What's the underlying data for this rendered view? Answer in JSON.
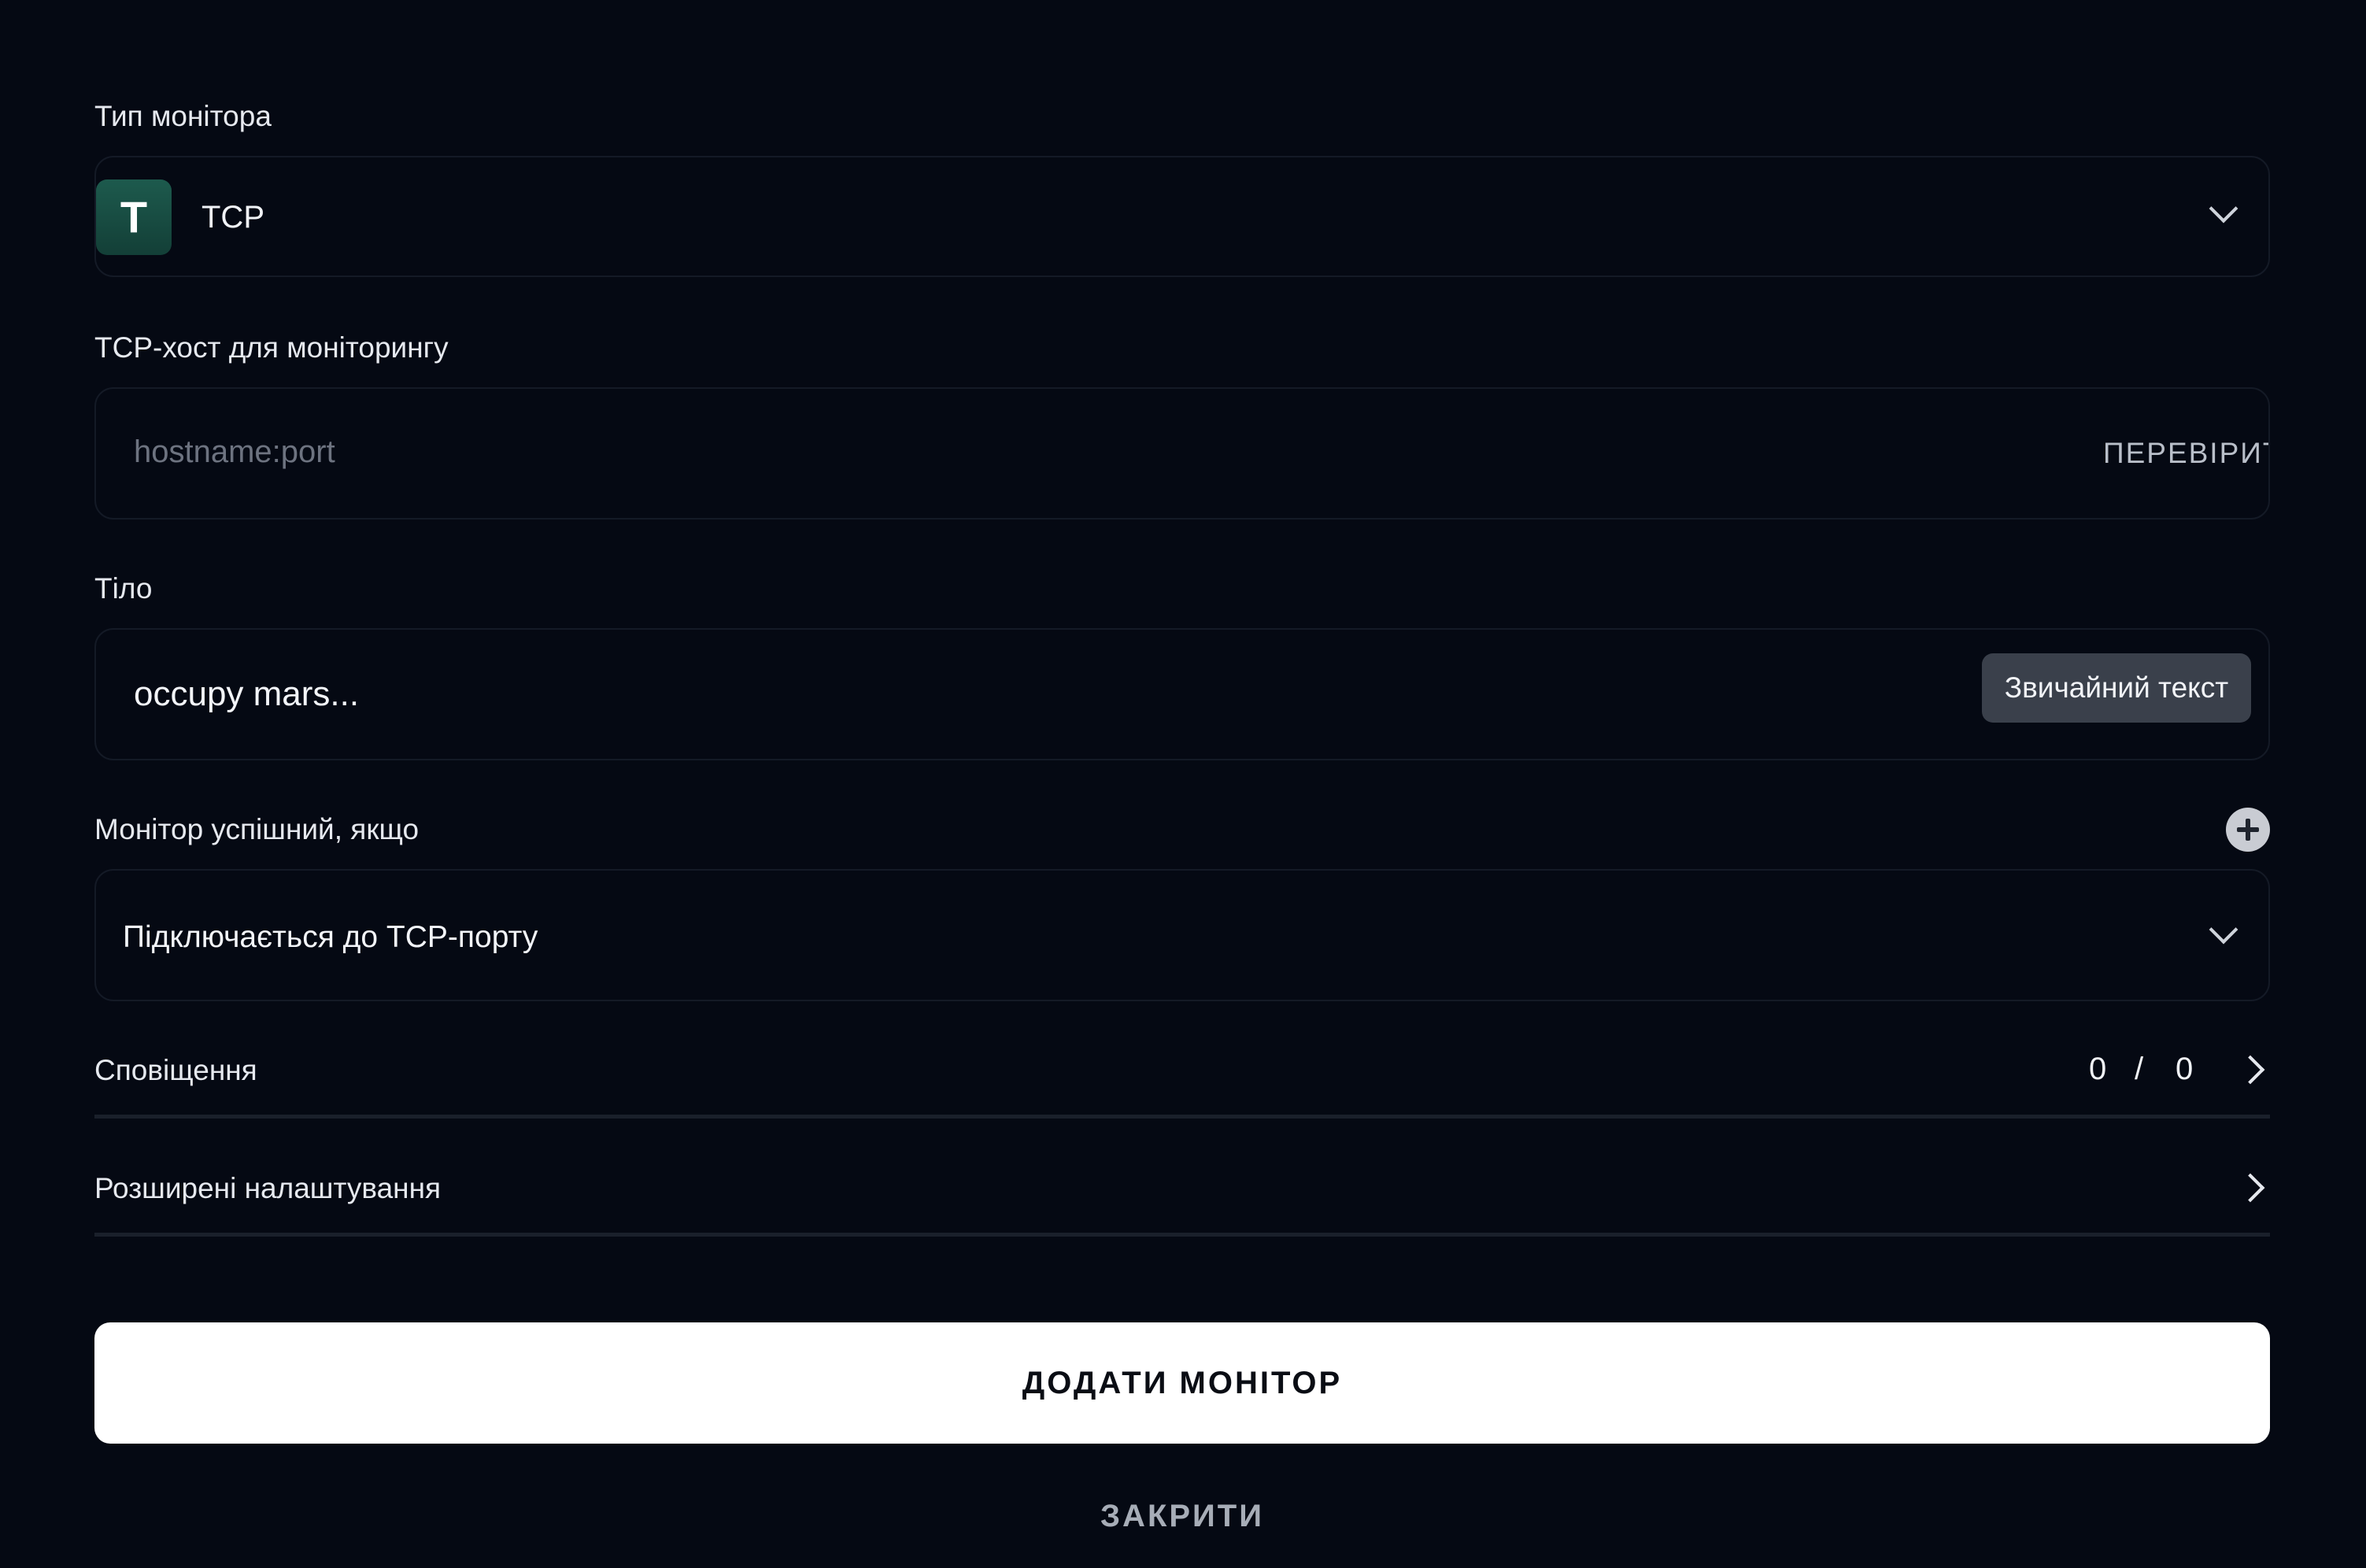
{
  "monitor_type": {
    "label": "Тип монітора",
    "icon_letter": "T",
    "value": "TCP",
    "icon_color": "#1d5a4d"
  },
  "tcp_host": {
    "label": "TCP-хост для моніторингу",
    "placeholder": "hostname:port",
    "value": "",
    "verify_label": "ПЕРЕВІРИТИ"
  },
  "body": {
    "label": "Тіло",
    "value": "occupy mars...",
    "format_label": "Звичайний текст"
  },
  "success_condition": {
    "label": "Монітор успішний, якщо",
    "value": "Підключається до TCP-порту"
  },
  "notifications": {
    "label": "Сповіщення",
    "count_selected": "0",
    "separator": "/",
    "count_total": "0"
  },
  "advanced": {
    "label": "Розширені налаштування"
  },
  "actions": {
    "add_label": "ДОДАТИ МОНІТОР",
    "close_label": "ЗАКРИТИ"
  },
  "colors": {
    "background": "#050913",
    "primary_button": "#ffffff",
    "accent_icon": "#1d5a4d"
  }
}
